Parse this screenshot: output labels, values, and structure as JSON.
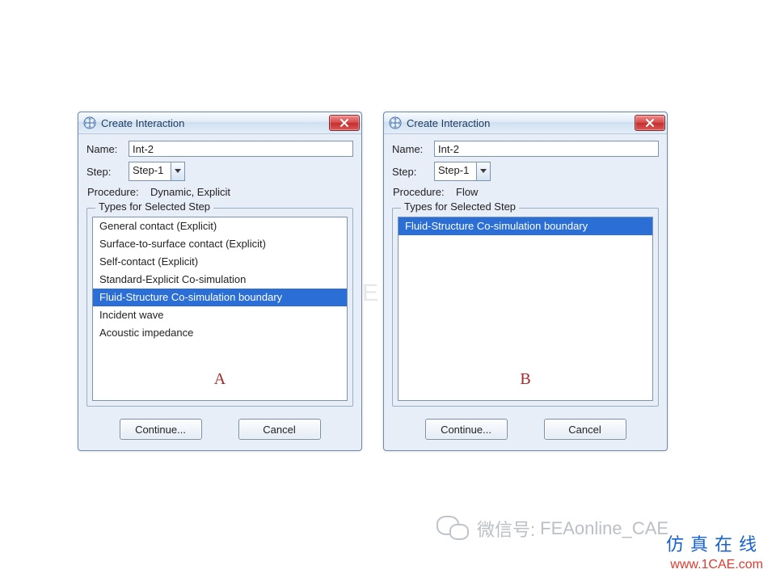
{
  "dialogA": {
    "title": "Create Interaction",
    "name_label": "Name:",
    "name_value": "Int-2",
    "step_label": "Step:",
    "step_value": "Step-1",
    "procedure_label": "Procedure:",
    "procedure_value": "Dynamic, Explicit",
    "group_label": "Types for Selected Step",
    "items": [
      {
        "label": "General contact (Explicit)",
        "selected": false
      },
      {
        "label": "Surface-to-surface contact (Explicit)",
        "selected": false
      },
      {
        "label": "Self-contact (Explicit)",
        "selected": false
      },
      {
        "label": "Standard-Explicit Co-simulation",
        "selected": false
      },
      {
        "label": "Fluid-Structure Co-simulation boundary",
        "selected": true
      },
      {
        "label": "Incident wave",
        "selected": false
      },
      {
        "label": "Acoustic impedance",
        "selected": false
      }
    ],
    "figure_label": "A",
    "continue_label": "Continue...",
    "cancel_label": "Cancel"
  },
  "dialogB": {
    "title": "Create Interaction",
    "name_label": "Name:",
    "name_value": "Int-2",
    "step_label": "Step:",
    "step_value": "Step-1",
    "procedure_label": "Procedure:",
    "procedure_value": "Flow",
    "group_label": "Types for Selected Step",
    "items": [
      {
        "label": "Fluid-Structure Co-simulation boundary",
        "selected": true
      }
    ],
    "figure_label": "B",
    "continue_label": "Continue...",
    "cancel_label": "Cancel"
  },
  "watermark": {
    "center": "1CAE.COM",
    "wechat_prefix": "微信号:",
    "wechat_id": "FEAonline_CAE",
    "brand_cn": "仿真在线",
    "brand_url": "www.1CAE.com"
  }
}
